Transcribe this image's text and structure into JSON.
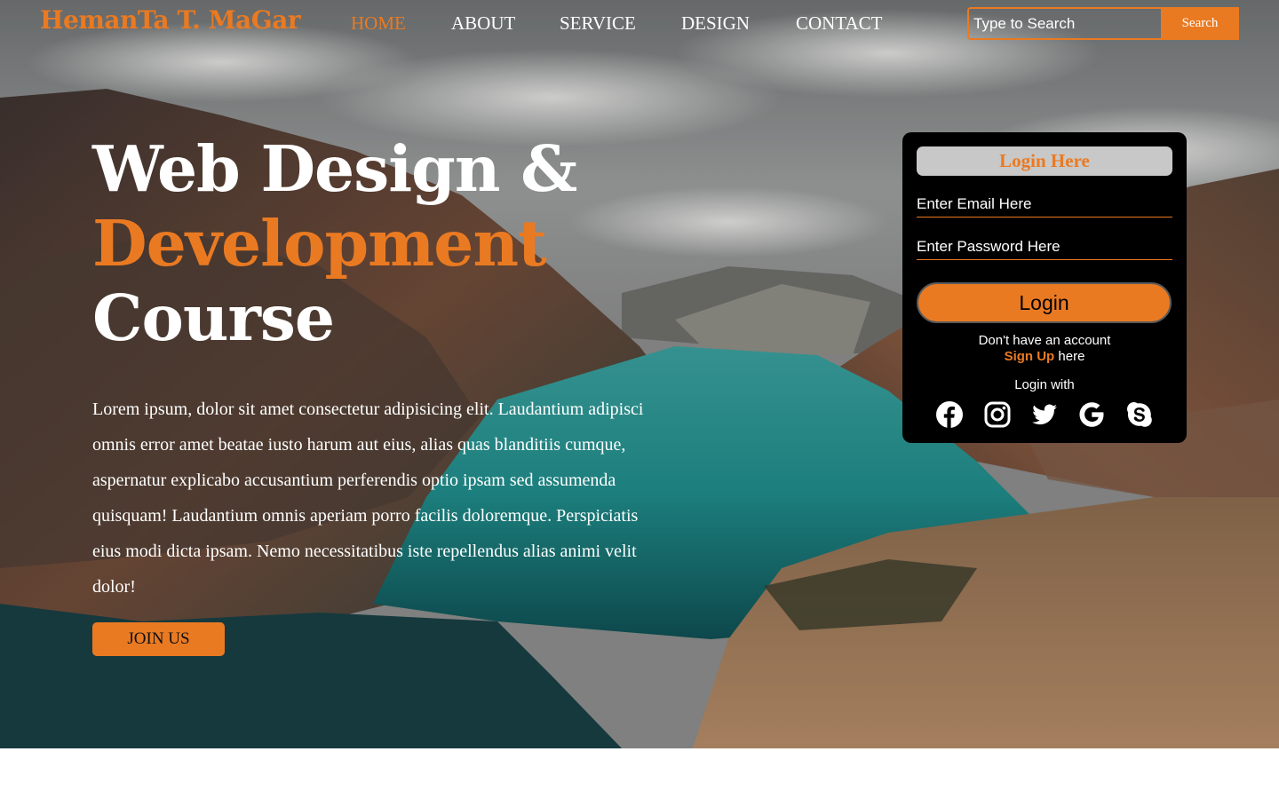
{
  "header": {
    "logo": "HemanTa T. MaGar",
    "nav": [
      {
        "label": "HOME",
        "active": true
      },
      {
        "label": "ABOUT",
        "active": false
      },
      {
        "label": "SERVICE",
        "active": false
      },
      {
        "label": "DESIGN",
        "active": false
      },
      {
        "label": "CONTACT",
        "active": false
      }
    ],
    "search": {
      "placeholder": "Type to Search",
      "button_label": "Search"
    }
  },
  "hero": {
    "title_line1": "Web Design &",
    "title_line2": "Development",
    "title_line3": "Course",
    "body": "Lorem ipsum, dolor sit amet consectetur adipisicing elit. Laudantium adipisci omnis error amet beatae iusto harum aut eius, alias quas blanditiis cumque, aspernatur explicabo accusantium perferendis optio ipsam sed assumenda quisquam! Laudantium omnis aperiam porro facilis doloremque. Perspiciatis eius modi dicta ipsam. Nemo necessitatibus iste repellendus alias animi velit dolor!",
    "join_label": "JOIN US"
  },
  "login": {
    "title": "Login Here",
    "email_placeholder": "Enter Email Here",
    "password_placeholder": "Enter Password Here",
    "button_label": "Login",
    "no_account_text": "Don't have an account",
    "signup_link": "Sign Up",
    "signup_suffix": "here",
    "login_with": "Login with",
    "social_icons": [
      "facebook-icon",
      "instagram-icon",
      "twitter-icon",
      "google-icon",
      "skype-icon"
    ]
  },
  "colors": {
    "accent": "#ea7a22",
    "card": "#000000",
    "title_bar": "#c8c8c8"
  }
}
